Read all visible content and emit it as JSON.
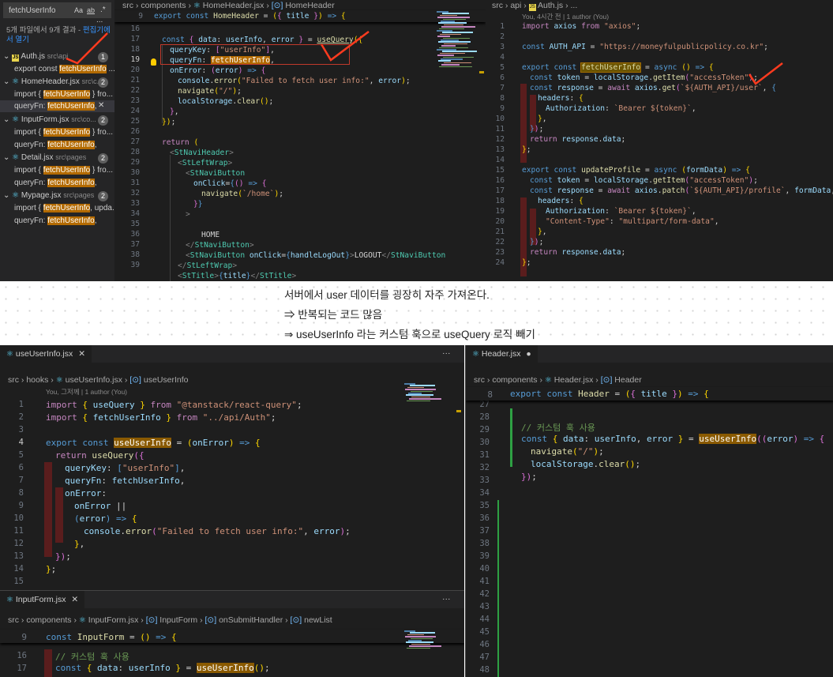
{
  "search": {
    "query": "fetchUserInfo",
    "opt_case": "Aa",
    "opt_word": "ab",
    "opt_regex": ".*",
    "more": "...",
    "summary": "5개 파일에서 9개 결과 - ",
    "open_link": "편집기에서 열기"
  },
  "results": [
    {
      "file": "Auth.js",
      "path": "src\\api",
      "count": "1",
      "lines": [
        {
          "pre": "export const ",
          "match": "fetchUserInfo",
          "post": " ..."
        }
      ]
    },
    {
      "file": "HomeHeader.jsx",
      "path": "src\\c...",
      "count": "2",
      "lines": [
        {
          "pre": "import { ",
          "match": "fetchUserInfo",
          "post": " } fro..."
        },
        {
          "pre": "queryFn: ",
          "match": "fetchUserInfo",
          "post": ",",
          "close": "✕"
        }
      ]
    },
    {
      "file": "InputForm.jsx",
      "path": "src\\co...",
      "count": "2",
      "lines": [
        {
          "pre": "import { ",
          "match": "fetchUserInfo",
          "post": " } fro..."
        },
        {
          "pre": "queryFn: ",
          "match": "fetchUserInfo",
          "post": ","
        }
      ]
    },
    {
      "file": "Detail.jsx",
      "path": "src\\pages",
      "count": "2",
      "lines": [
        {
          "pre": "import { ",
          "match": "fetchUserInfo",
          "post": " } fro..."
        },
        {
          "pre": "queryFn: ",
          "match": "fetchUserInfo",
          "post": ","
        }
      ]
    },
    {
      "file": "Mypage.jsx",
      "path": "src\\pages",
      "count": "2",
      "lines": [
        {
          "pre": "import { ",
          "match": "fetchUserInfo",
          "post": ", upda..."
        },
        {
          "pre": "queryFn: ",
          "match": "fetchUserInfo",
          "post": ","
        }
      ]
    }
  ],
  "homeheader": {
    "crumb": [
      "src",
      "components",
      "HomeHeader.jsx",
      "HomeHeader"
    ],
    "sticky_num": "9",
    "sticky": "export const HomeHeader = ({ title }) => {",
    "line_numbers": [
      "16",
      "17",
      "18",
      "19",
      "20",
      "21",
      "22",
      "23",
      "24",
      "25",
      "26",
      "27",
      "28",
      "29",
      "30",
      "31",
      "32",
      "33",
      "34",
      "35",
      "36",
      "37",
      "38",
      "39"
    ],
    "current_line": "19"
  },
  "auth": {
    "crumb": [
      "src",
      "api",
      "Auth.js",
      "..."
    ],
    "blame": "You, 4시간 전 | 1 author (You)",
    "line_numbers": [
      "1",
      "2",
      "3",
      "4",
      "5",
      "6",
      "7",
      "8",
      "9",
      "10",
      "11",
      "12",
      "13",
      "14",
      "15",
      "16",
      "17",
      "18",
      "19",
      "20",
      "21",
      "22",
      "23",
      "24"
    ],
    "api_url": "\"https://moneyfulpublicpolicy.co.kr\""
  },
  "notes": [
    "서버에서 user 데이터를 굉장히 자주 가져온다.",
    "⇒ 반복되는 코드 많음",
    "⇒ useUserInfo 라는 커스텀 훅으로 useQuery 로직 빼기"
  ],
  "useuserinfo": {
    "tab": "useUserInfo.jsx",
    "tab_close": "✕",
    "more": "···",
    "crumb": [
      "src",
      "hooks",
      "useUserInfo.jsx",
      "useUserInfo"
    ],
    "blame": "You, 그저께 | 1 author (You)",
    "line_numbers": [
      "1",
      "2",
      "3",
      "4",
      "5",
      "6",
      "7",
      "8",
      "9",
      "10",
      "11",
      "12",
      "13",
      "14",
      "15"
    ],
    "current_line": "4"
  },
  "header": {
    "tab": "Header.jsx",
    "dirty": "●",
    "more": "···",
    "crumb": [
      "src",
      "components",
      "Header.jsx",
      "Header"
    ],
    "sticky_num": "8",
    "sticky": "export const Header = ({ title }) => {",
    "line_numbers": [
      "27",
      "28",
      "29",
      "30",
      "31",
      "32",
      "33",
      "34",
      "35",
      "36",
      "37",
      "38",
      "39",
      "40",
      "41",
      "42",
      "43",
      "44",
      "45",
      "46",
      "47",
      "48"
    ],
    "comment": "// 커스텀 훅 사용"
  },
  "inputform": {
    "tab": "InputForm.jsx",
    "tab_close": "✕",
    "more": "···",
    "crumb": [
      "src",
      "components",
      "InputForm.jsx",
      "InputForm",
      "onSubmitHandler",
      "newList"
    ],
    "sticky_num": "9",
    "sticky": "const InputForm = () => {",
    "line_numbers": [
      "16",
      "17"
    ],
    "comment": "// 커스텀 훅 사용"
  }
}
